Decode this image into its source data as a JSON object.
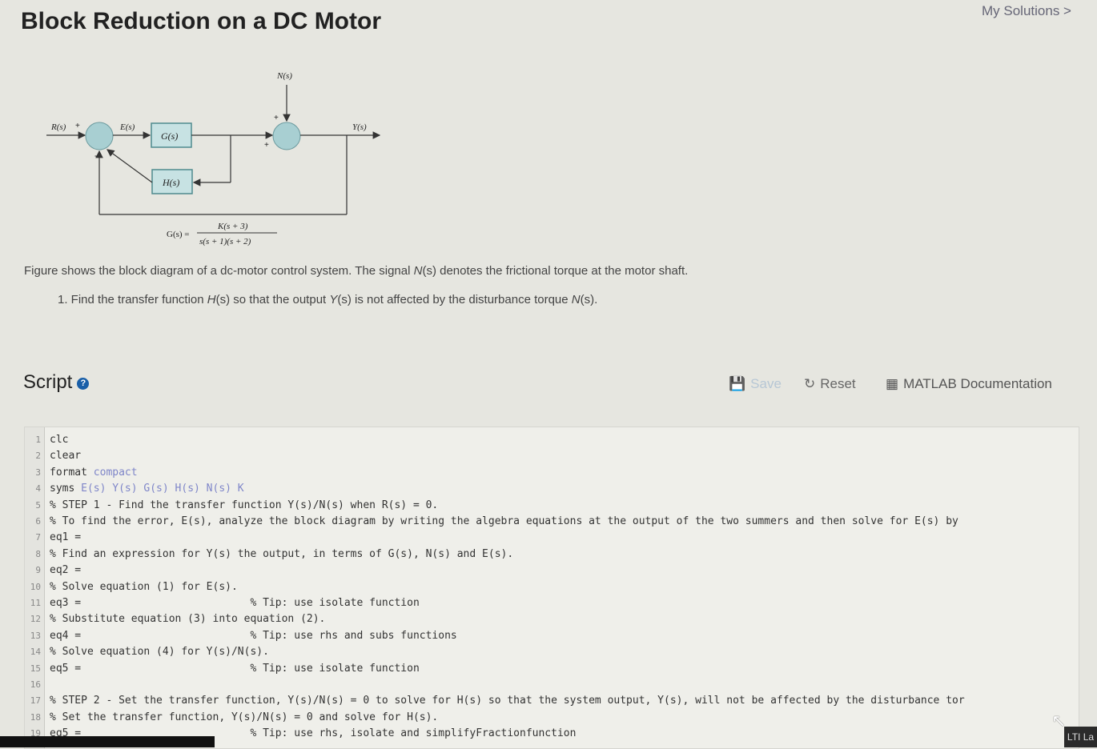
{
  "header": {
    "title": "Block Reduction on a DC Motor",
    "my_solutions": "My Solutions >"
  },
  "diagram": {
    "labels": {
      "R": "R(s)",
      "E": "E(s)",
      "G": "G(s)",
      "H": "H(s)",
      "N": "N(s)",
      "Y": "Y(s)",
      "plus": "+",
      "minus": "-"
    },
    "equation": {
      "lhs": "G(s) =",
      "numerator": "K(s + 3)",
      "denominator": "s(s + 1)(s + 2)"
    }
  },
  "problem": {
    "description_pre": "Figure shows the block diagram of a dc-motor control system. The signal ",
    "description_var": "N",
    "description_post": "(s) denotes the frictional torque at the motor shaft.",
    "task_pre": "1. Find the transfer function ",
    "task_H": "H",
    "task_mid1": "(s) so that the output ",
    "task_Y": "Y",
    "task_mid2": "(s) is not affected by the disturbance torque ",
    "task_N": "N",
    "task_end": "(s)."
  },
  "script": {
    "title": "Script",
    "help_icon": "question-circle-icon",
    "toolbar": {
      "save_label": "Save",
      "reset_label": "Reset",
      "doc_label": "MATLAB Documentation"
    },
    "lines": [
      {
        "n": "1",
        "kw": "clc",
        "arg": ""
      },
      {
        "n": "2",
        "kw": "clear",
        "arg": ""
      },
      {
        "n": "3",
        "kw": "format ",
        "arg": "compact"
      },
      {
        "n": "4",
        "kw": "syms ",
        "arg": "E(s) Y(s) G(s) H(s) N(s) K"
      },
      {
        "n": "5",
        "kw": "% STEP 1 - Find the transfer function Y(s)/N(s) when R(s) = 0.",
        "arg": ""
      },
      {
        "n": "6",
        "kw": "% To find the error, E(s), analyze the block diagram by writing the algebra equations at the output of the two summers and then solve for E(s) by",
        "arg": ""
      },
      {
        "n": "7",
        "kw": "eq1 =",
        "arg": ""
      },
      {
        "n": "8",
        "kw": "% Find an expression for Y(s) the output, in terms of G(s), N(s) and E(s).",
        "arg": ""
      },
      {
        "n": "9",
        "kw": "eq2 =",
        "arg": ""
      },
      {
        "n": "10",
        "kw": "% Solve equation (1) for E(s).",
        "arg": ""
      },
      {
        "n": "11",
        "kw": "eq3 =                           % Tip: use isolate function",
        "arg": ""
      },
      {
        "n": "12",
        "kw": "% Substitute equation (3) into equation (2).",
        "arg": ""
      },
      {
        "n": "13",
        "kw": "eq4 =                           % Tip: use rhs and subs functions",
        "arg": ""
      },
      {
        "n": "14",
        "kw": "% Solve equation (4) for Y(s)/N(s).",
        "arg": ""
      },
      {
        "n": "15",
        "kw": "eq5 =                           % Tip: use isolate function",
        "arg": ""
      },
      {
        "n": "16",
        "kw": "",
        "arg": ""
      },
      {
        "n": "17",
        "kw": "% STEP 2 - Set the transfer function, Y(s)/N(s) = 0 to solve for H(s) so that the system output, Y(s), will not be affected by the disturbance tor",
        "arg": ""
      },
      {
        "n": "18",
        "kw": "% Set the transfer function, Y(s)/N(s) = 0 and solve for H(s).",
        "arg": ""
      },
      {
        "n": "19",
        "kw": "eq5 =                           % Tip: use rhs, isolate and simplifyFractionfunction",
        "arg": ""
      }
    ]
  },
  "taskbar": {
    "lti_label": "LTI La"
  }
}
